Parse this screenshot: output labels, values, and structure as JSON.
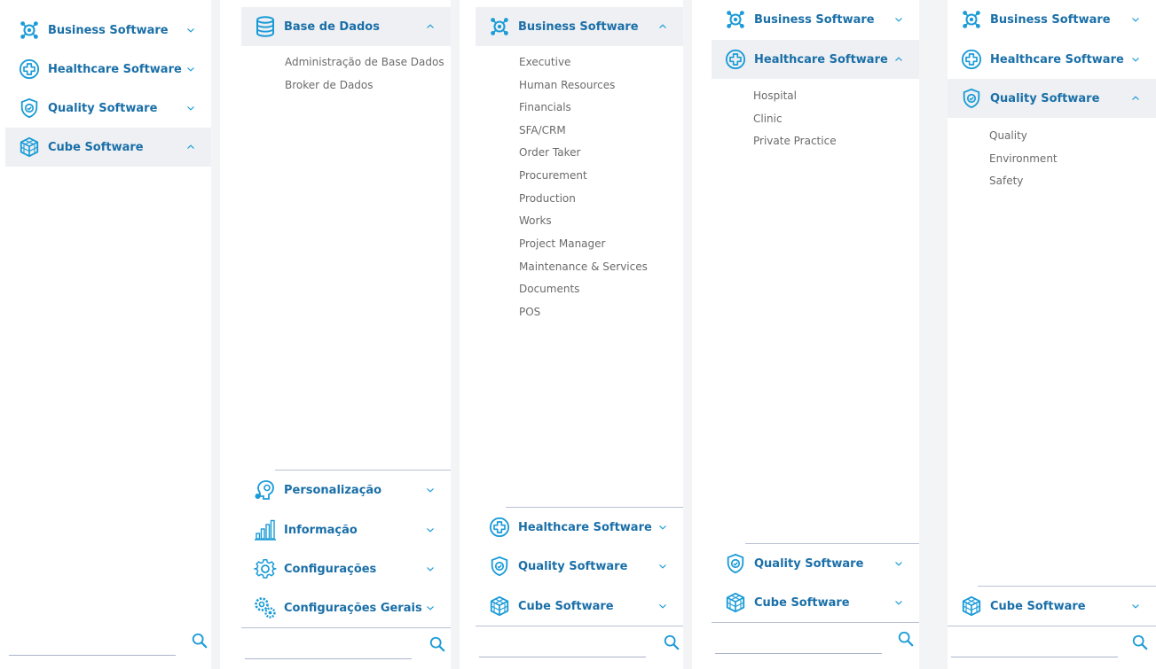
{
  "colors": {
    "accent": "#1a9bd7",
    "label": "#1a6fa8",
    "sub": "#6b6b6b",
    "active_bg": "#eef0f3"
  },
  "panel1": {
    "items": [
      {
        "label": "Business Software",
        "icon": "business-icon",
        "state": "collapsed"
      },
      {
        "label": "Healthcare Software",
        "icon": "healthcare-icon",
        "state": "collapsed"
      },
      {
        "label": "Quality Software",
        "icon": "quality-shield-icon",
        "state": "collapsed"
      },
      {
        "label": "Cube Software",
        "icon": "cube-icon",
        "state": "expanded"
      }
    ],
    "search": {
      "placeholder": "",
      "icon": "search-icon"
    }
  },
  "panel2": {
    "header": {
      "label": "Base de Dados",
      "icon": "database-icon",
      "state": "expanded"
    },
    "subitems": [
      "Administração de Base Dados",
      "Broker de Dados"
    ],
    "footer_items": [
      {
        "label": "Personalização",
        "icon": "personalization-icon"
      },
      {
        "label": "Informação",
        "icon": "bar-chart-icon"
      },
      {
        "label": "Configurações",
        "icon": "settings-icon"
      },
      {
        "label": "Configurações Gerais",
        "icon": "general-settings-icon"
      }
    ],
    "search": {
      "placeholder": "",
      "icon": "search-icon"
    }
  },
  "panel3": {
    "header": {
      "label": "Business Software",
      "icon": "business-icon",
      "state": "expanded"
    },
    "subitems": [
      "Executive",
      "Human Resources",
      "Financials",
      "SFA/CRM",
      "Order Taker",
      "Procurement",
      "Production",
      "Works",
      "Project Manager",
      "Maintenance & Services",
      "Documents",
      "POS"
    ],
    "footer_items": [
      {
        "label": "Healthcare Software",
        "icon": "healthcare-icon"
      },
      {
        "label": "Quality Software",
        "icon": "quality-shield-icon"
      },
      {
        "label": "Cube Software",
        "icon": "cube-icon"
      }
    ],
    "search": {
      "placeholder": "",
      "icon": "search-icon"
    }
  },
  "panel4": {
    "top": {
      "label": "Business Software",
      "icon": "business-icon"
    },
    "header": {
      "label": "Healthcare Software",
      "icon": "healthcare-icon",
      "state": "expanded"
    },
    "subitems": [
      "Hospital",
      "Clinic",
      "Private Practice"
    ],
    "footer_items": [
      {
        "label": "Quality Software",
        "icon": "quality-shield-icon"
      },
      {
        "label": "Cube Software",
        "icon": "cube-icon"
      }
    ],
    "search": {
      "placeholder": "",
      "icon": "search-icon"
    }
  },
  "panel5": {
    "top": [
      {
        "label": "Business Software",
        "icon": "business-icon"
      },
      {
        "label": "Healthcare Software",
        "icon": "healthcare-icon"
      }
    ],
    "header": {
      "label": "Quality Software",
      "icon": "quality-shield-icon",
      "state": "expanded"
    },
    "subitems": [
      "Quality",
      "Environment",
      "Safety"
    ],
    "footer_items": [
      {
        "label": "Cube Software",
        "icon": "cube-icon"
      }
    ],
    "search": {
      "placeholder": "",
      "icon": "search-icon"
    }
  }
}
